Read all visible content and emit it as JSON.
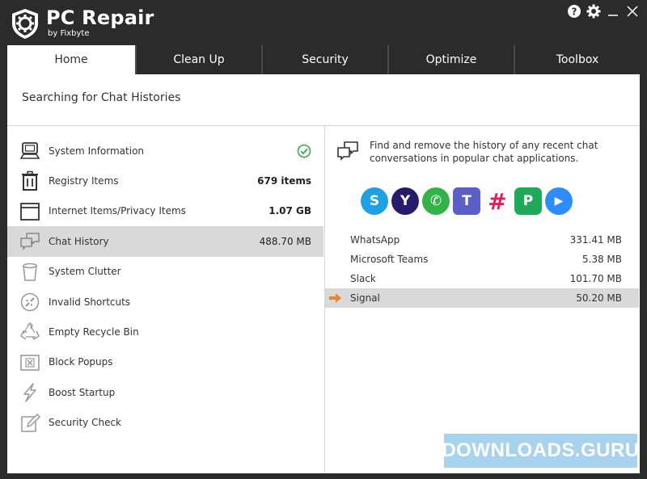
{
  "app": {
    "title": "PC Repair",
    "subtitle": "by Fixbyte"
  },
  "window_controls": {
    "help": "?",
    "settings": "gear",
    "minimize": "—",
    "close": "✕"
  },
  "tabs": [
    {
      "label": "Home"
    },
    {
      "label": "Clean Up"
    },
    {
      "label": "Security"
    },
    {
      "label": "Optimize"
    },
    {
      "label": "Toolbox"
    }
  ],
  "header": {
    "status": "Searching for Chat Histories"
  },
  "scan_items": [
    {
      "label": "System Information",
      "value": "",
      "icon": "computer-icon"
    },
    {
      "label": "Registry Items",
      "value": "679 items",
      "icon": "trash-icon"
    },
    {
      "label": "Internet Items/Privacy Items",
      "value": "1.07 GB",
      "icon": "browser-window-icon"
    },
    {
      "label": "Chat History",
      "value": "488.70 MB",
      "icon": "chat-bubbles-icon"
    },
    {
      "label": "System Clutter",
      "value": "",
      "icon": "bin-icon"
    },
    {
      "label": "Invalid Shortcuts",
      "value": "",
      "icon": "broken-link-icon"
    },
    {
      "label": "Empty Recycle Bin",
      "value": "",
      "icon": "recycle-icon"
    },
    {
      "label": "Block Popups",
      "value": "",
      "icon": "block-popup-icon"
    },
    {
      "label": "Boost Startup",
      "value": "",
      "icon": "lightning-icon"
    },
    {
      "label": "Security Check",
      "value": "",
      "icon": "edit-check-icon"
    }
  ],
  "detail": {
    "description": "Find and remove the history of any recent chat conversations in popular chat applications.",
    "apps": [
      {
        "name": "skype-icon",
        "glyph": "S",
        "color": "#1ea0e3"
      },
      {
        "name": "yahoo-icon",
        "glyph": "Y",
        "color": "#2a1a6b"
      },
      {
        "name": "whatsapp-icon",
        "glyph": "✆",
        "color": "#34b24a"
      },
      {
        "name": "teams-icon",
        "glyph": "T",
        "color": "#5b5fc7"
      },
      {
        "name": "slack-icon",
        "glyph": "#",
        "color": "#e01e5a"
      },
      {
        "name": "pinngle-icon",
        "glyph": "P",
        "color": "#1faa5b"
      },
      {
        "name": "zoom-icon",
        "glyph": "▶",
        "color": "#2d8cff"
      }
    ],
    "results": [
      {
        "name": "WhatsApp",
        "size": "331.41 MB"
      },
      {
        "name": "Microsoft Teams",
        "size": "5.38 MB"
      },
      {
        "name": "Slack",
        "size": "101.70 MB"
      },
      {
        "name": "Signal",
        "size": "50.20 MB"
      }
    ]
  },
  "watermark": {
    "text": "DOWNLOADS.GURU"
  },
  "colors": {
    "titlebar": "#2b2b2b",
    "selected": "#d9d9d9",
    "check": "#3aa655",
    "arrow": "#f0832a"
  }
}
